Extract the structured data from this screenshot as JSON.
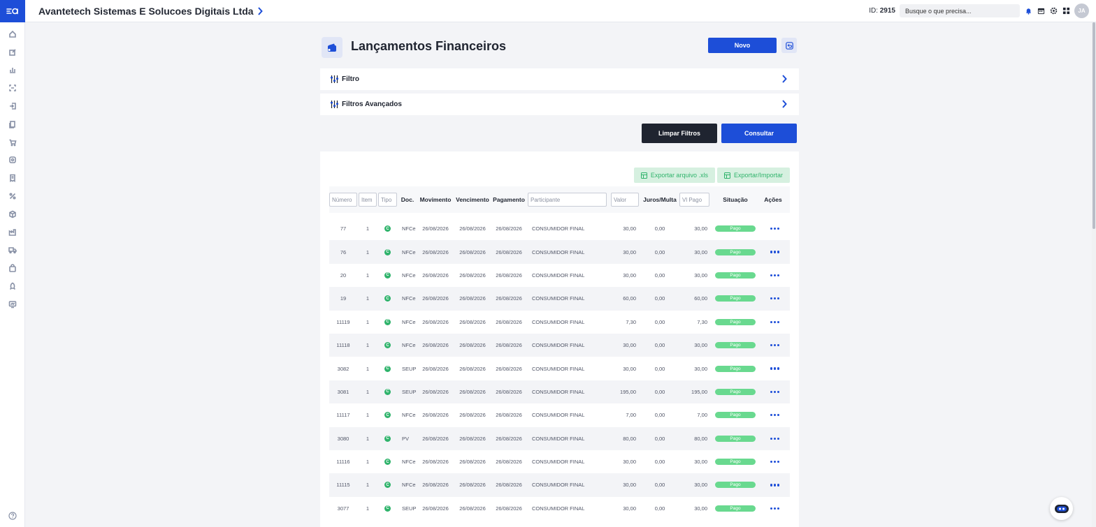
{
  "app": {
    "company_name": "Avantetech Sistemas E Solucoes Digitais Ltda",
    "id_label": "ID:",
    "id_value": "2915",
    "search_placeholder": "Busque o que precisa...",
    "avatar_initials": "JA"
  },
  "page": {
    "title": "Lançamentos Financeiros",
    "new_button": "Novo"
  },
  "filters": {
    "filter_label": "Filtro",
    "advanced_label": "Filtros Avançados",
    "clear_button": "Limpar Filtros",
    "query_button": "Consultar"
  },
  "exports": {
    "export_xls": "Exportar arquivo .xls",
    "export_import": "Exportar/Importar"
  },
  "table": {
    "placeholders": {
      "numero": "Número",
      "item": "Item",
      "tipo": "Tipo",
      "participante": "Participante",
      "valor": "Valor",
      "vlpago": "Vl Pago"
    },
    "headers": {
      "doc": "Doc.",
      "movimento": "Movimento",
      "vencimento": "Vencimento",
      "pagamento": "Pagamento",
      "juros": "Juros/Multa",
      "situacao": "Situação",
      "acoes": "Ações"
    },
    "rows": [
      {
        "numero": "77",
        "item": "1",
        "tipo": "C",
        "doc": "NFCe",
        "movimento": "26/08/2026",
        "vencimento": "26/08/2026",
        "pagamento": "26/08/2026",
        "participante": "CONSUMIDOR FINAL",
        "valor": "30,00",
        "juros": "0,00",
        "vlpago": "30,00",
        "situacao": "Pago"
      },
      {
        "numero": "76",
        "item": "1",
        "tipo": "C",
        "doc": "NFCe",
        "movimento": "26/08/2026",
        "vencimento": "26/08/2026",
        "pagamento": "26/08/2026",
        "participante": "CONSUMIDOR FINAL",
        "valor": "30,00",
        "juros": "0,00",
        "vlpago": "30,00",
        "situacao": "Pago"
      },
      {
        "numero": "20",
        "item": "1",
        "tipo": "C",
        "doc": "NFCe",
        "movimento": "26/08/2026",
        "vencimento": "26/08/2026",
        "pagamento": "26/08/2026",
        "participante": "CONSUMIDOR FINAL",
        "valor": "30,00",
        "juros": "0,00",
        "vlpago": "30,00",
        "situacao": "Pago"
      },
      {
        "numero": "19",
        "item": "1",
        "tipo": "C",
        "doc": "NFCe",
        "movimento": "26/08/2026",
        "vencimento": "26/08/2026",
        "pagamento": "26/08/2026",
        "participante": "CONSUMIDOR FINAL",
        "valor": "60,00",
        "juros": "0,00",
        "vlpago": "60,00",
        "situacao": "Pago"
      },
      {
        "numero": "11119",
        "item": "1",
        "tipo": "C",
        "doc": "NFCe",
        "movimento": "26/08/2026",
        "vencimento": "26/08/2026",
        "pagamento": "26/08/2026",
        "participante": "CONSUMIDOR FINAL",
        "valor": "7,30",
        "juros": "0,00",
        "vlpago": "7,30",
        "situacao": "Pago"
      },
      {
        "numero": "11118",
        "item": "1",
        "tipo": "C",
        "doc": "NFCe",
        "movimento": "26/08/2026",
        "vencimento": "26/08/2026",
        "pagamento": "26/08/2026",
        "participante": "CONSUMIDOR FINAL",
        "valor": "30,00",
        "juros": "0,00",
        "vlpago": "30,00",
        "situacao": "Pago"
      },
      {
        "numero": "3082",
        "item": "1",
        "tipo": "C",
        "doc": "SEUPDV",
        "movimento": "26/08/2026",
        "vencimento": "26/08/2026",
        "pagamento": "26/08/2026",
        "participante": "CONSUMIDOR FINAL",
        "valor": "30,00",
        "juros": "0,00",
        "vlpago": "30,00",
        "situacao": "Pago"
      },
      {
        "numero": "3081",
        "item": "1",
        "tipo": "C",
        "doc": "SEUPDV",
        "movimento": "26/08/2026",
        "vencimento": "26/08/2026",
        "pagamento": "26/08/2026",
        "participante": "CONSUMIDOR FINAL",
        "valor": "195,00",
        "juros": "0,00",
        "vlpago": "195,00",
        "situacao": "Pago"
      },
      {
        "numero": "11117",
        "item": "1",
        "tipo": "C",
        "doc": "NFCe",
        "movimento": "26/08/2026",
        "vencimento": "26/08/2026",
        "pagamento": "26/08/2026",
        "participante": "CONSUMIDOR FINAL",
        "valor": "7,00",
        "juros": "0,00",
        "vlpago": "7,00",
        "situacao": "Pago"
      },
      {
        "numero": "3080",
        "item": "1",
        "tipo": "C",
        "doc": "PV",
        "movimento": "26/08/2026",
        "vencimento": "26/08/2026",
        "pagamento": "26/08/2026",
        "participante": "CONSUMIDOR FINAL",
        "valor": "80,00",
        "juros": "0,00",
        "vlpago": "80,00",
        "situacao": "Pago"
      },
      {
        "numero": "11116",
        "item": "1",
        "tipo": "C",
        "doc": "NFCe",
        "movimento": "26/08/2026",
        "vencimento": "26/08/2026",
        "pagamento": "26/08/2026",
        "participante": "CONSUMIDOR FINAL",
        "valor": "30,00",
        "juros": "0,00",
        "vlpago": "30,00",
        "situacao": "Pago"
      },
      {
        "numero": "11115",
        "item": "1",
        "tipo": "C",
        "doc": "NFCe",
        "movimento": "26/08/2026",
        "vencimento": "26/08/2026",
        "pagamento": "26/08/2026",
        "participante": "CONSUMIDOR FINAL",
        "valor": "30,00",
        "juros": "0,00",
        "vlpago": "30,00",
        "situacao": "Pago"
      },
      {
        "numero": "3077",
        "item": "1",
        "tipo": "C",
        "doc": "SEUPDV",
        "movimento": "26/08/2026",
        "vencimento": "26/08/2026",
        "pagamento": "26/08/2026",
        "participante": "CONSUMIDOR FINAL",
        "valor": "30,00",
        "juros": "0,00",
        "vlpago": "30,00",
        "situacao": "Pago"
      }
    ]
  },
  "colors": {
    "primary": "#1d4ed8",
    "dark_button": "#1f2430",
    "success": "#2fb36b",
    "paid_badge": "#69d98f",
    "export_bg": "#d6f0e0"
  },
  "icons": {
    "sidebar": [
      "home-icon",
      "edit-icon",
      "chart-icon",
      "scan-icon",
      "login-icon",
      "documents-icon",
      "cart-icon",
      "target-icon",
      "receipt-icon",
      "percent-icon",
      "box-icon",
      "factory-icon",
      "truck-icon",
      "bag-icon",
      "rocket-icon",
      "monitor-icon"
    ],
    "footer": "help-icon"
  }
}
